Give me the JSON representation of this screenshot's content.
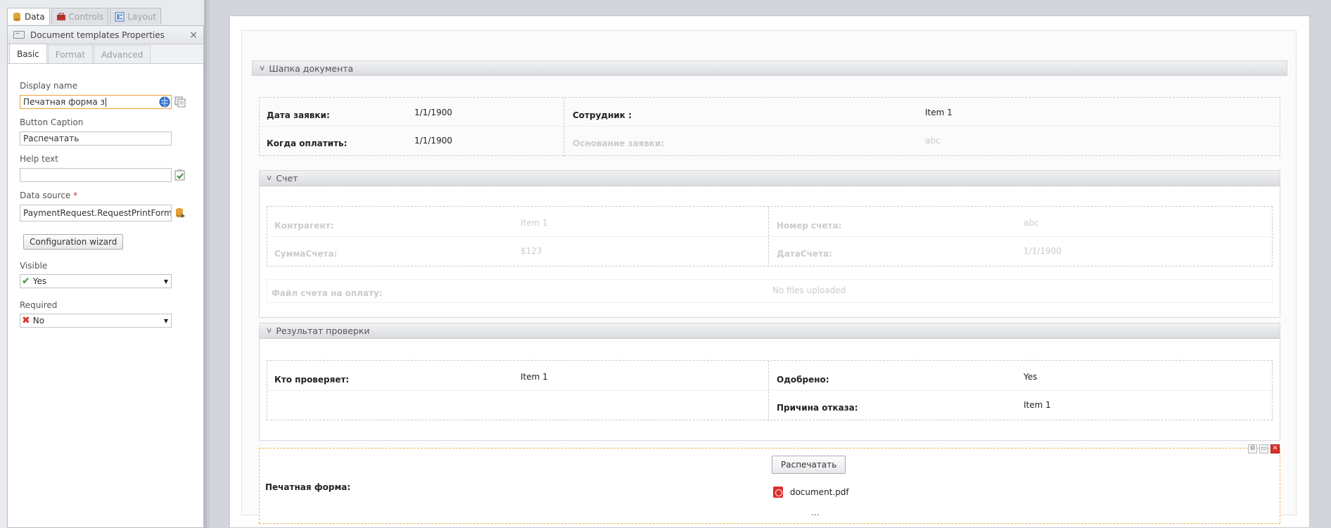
{
  "top_tabs": [
    {
      "label": "Data",
      "icon": "database-icon"
    },
    {
      "label": "Controls",
      "icon": "toolbox-icon"
    },
    {
      "label": "Layout",
      "icon": "layout-icon"
    }
  ],
  "props": {
    "title": "Document templates Properties",
    "close": "×",
    "tabs": [
      "Basic",
      "Format",
      "Advanced"
    ],
    "fields": {
      "display_name_label": "Display name",
      "display_name_value": "Печатная форма з",
      "button_caption_label": "Button Caption",
      "button_caption_value": "Распечатать",
      "help_text_label": "Help text",
      "help_text_value": "",
      "data_source_label": "Data source",
      "data_source_required": "*",
      "data_source_value": "PaymentRequest.RequestPrintForm",
      "config_wizard": "Configuration wizard",
      "visible_label": "Visible",
      "visible_value": "Yes",
      "required_label": "Required",
      "required_value": "No"
    }
  },
  "form": {
    "header_section": {
      "title": "Шапка документа",
      "rows": {
        "date_label": "Дата заявки:",
        "date_value": "1/1/1900",
        "pay_label": "Когда оплатить:",
        "pay_value": "1/1/1900",
        "employee_label": "Сотрудник :",
        "employee_value": "Item 1",
        "basis_label": "Основание заявки:",
        "basis_value": "abc"
      }
    },
    "invoice_section": {
      "title": "Счет",
      "rows": {
        "counterparty_label": "Контрагент:",
        "counterparty_value": "Item 1",
        "sum_label": "СуммаСчета:",
        "sum_value": "$123",
        "number_label": "Номер счета:",
        "number_value": "abc",
        "invoice_date_label": "ДатаСчета:",
        "invoice_date_value": "1/1/1900",
        "file_label": "Файл счета на оплату:",
        "file_value": "No files uploaded"
      }
    },
    "check_section": {
      "title": "Результат проверки",
      "rows": {
        "checker_label": "Кто проверяет:",
        "checker_value": "Item 1",
        "approved_label": "Одобрено:",
        "approved_value": "Yes",
        "reject_label": "Причина отказа:",
        "reject_value": "Item 1"
      }
    },
    "print_block": {
      "label": "Печатная форма:",
      "button": "Распечатать",
      "file": "document.pdf",
      "more": "..."
    }
  },
  "colors": {
    "accent_orange": "#f0b54a",
    "close_red": "#d9302a",
    "yes_green": "#2f9b2f",
    "no_red": "#d9302a"
  }
}
